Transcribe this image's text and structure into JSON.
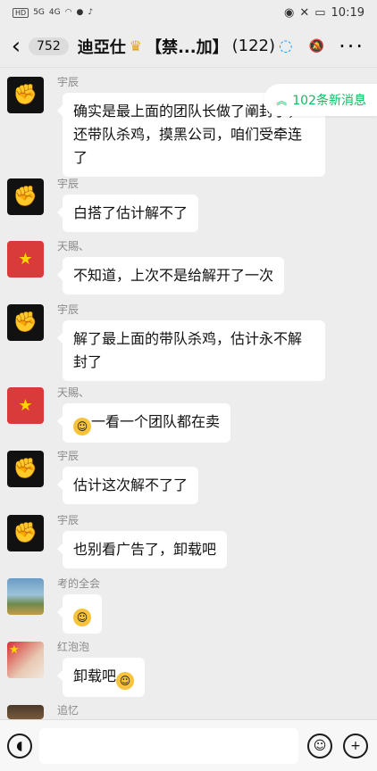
{
  "statusbar": {
    "time": "10:19",
    "net_left": "HD",
    "net_label": "5G",
    "net_label2": "4G"
  },
  "header": {
    "unread_count": "752",
    "chat_title": "迪亞仕",
    "title_suffix": "【禁...加】",
    "member_count": "(122)"
  },
  "new_messages_label": "102条新消息",
  "messages": [
    {
      "sender": "宇辰",
      "text": "确实是最上面的团队长做了阐封了，还带队杀鸡，摸黑公司，咱们受牵连了"
    },
    {
      "sender": "宇辰",
      "text": "白搭了估计解不了"
    },
    {
      "sender": "天賜、",
      "text": "不知道，上次不是给解开了一次"
    },
    {
      "sender": "宇辰",
      "text": "解了最上面的带队杀鸡，估计永不解封了"
    },
    {
      "sender": "天賜、",
      "text": "一看一个团队都在卖"
    },
    {
      "sender": "宇辰",
      "text": "估计这次解不了了"
    },
    {
      "sender": "宇辰",
      "text": "也别看广告了，卸载吧"
    },
    {
      "sender": "考的全会",
      "text": ""
    },
    {
      "sender": "红泡泡",
      "text": "卸载吧"
    },
    {
      "sender": "追忆",
      "text": ""
    }
  ],
  "colors": {
    "accent": "#07c160",
    "background": "#ededed",
    "bubble": "#ffffff"
  }
}
